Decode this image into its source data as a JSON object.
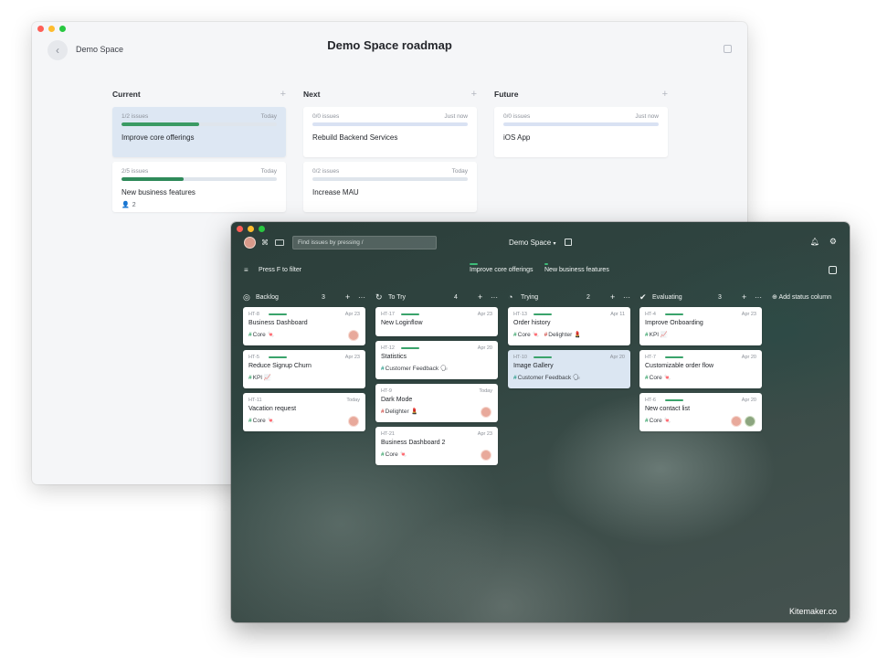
{
  "roadmap": {
    "space_name": "Demo Space",
    "title": "Demo Space roadmap",
    "columns": [
      {
        "title": "Current",
        "cards": [
          {
            "issues": "1/2 issues",
            "time": "Today",
            "progress": 0.5,
            "title": "Improve core offerings",
            "selected": true
          },
          {
            "issues": "2/5 issues",
            "time": "Today",
            "progress": 0.4,
            "title": "New business features",
            "members": "2"
          }
        ]
      },
      {
        "title": "Next",
        "cards": [
          {
            "issues": "0/0 issues",
            "time": "Just now",
            "progress": 0,
            "title": "Rebuild Backend Services"
          },
          {
            "issues": "0/2 issues",
            "time": "Today",
            "progress": 0,
            "title": "Increase MAU"
          }
        ]
      },
      {
        "title": "Future",
        "cards": [
          {
            "issues": "0/0 issues",
            "time": "Just now",
            "progress": 0,
            "title": "iOS App"
          }
        ]
      }
    ]
  },
  "board": {
    "cmd_glyph": "⌘",
    "search_placeholder": "Find issues by pressing /",
    "space_name": "Demo Space",
    "space_caret": "▾",
    "filter_text": "Press F to filter",
    "initiatives": [
      "Improve core offerings",
      "New business features"
    ],
    "add_status": "Add status column",
    "brand": "Kitemaker.co",
    "columns": [
      {
        "name": "Backlog",
        "count": "3",
        "icon": "◎",
        "cards": [
          {
            "id": "HT-8",
            "date": "Apr 23",
            "title": "Business Dashboard",
            "labels": [
              {
                "text": "Core",
                "emoji": "🍬"
              }
            ],
            "assignee": true
          },
          {
            "id": "HT-5",
            "date": "Apr 23",
            "title": "Reduce Signup Churn",
            "labels": [
              {
                "text": "KPI",
                "emoji": "📈"
              }
            ]
          },
          {
            "id": "HT-11",
            "date": "Today",
            "title": "Vacation request",
            "labels": [
              {
                "text": "Core",
                "emoji": "🍬"
              }
            ],
            "assignee": true
          }
        ]
      },
      {
        "name": "To Try",
        "count": "4",
        "icon": "↻",
        "cards": [
          {
            "id": "HT-17",
            "date": "Apr 23",
            "title": "New Loginflow",
            "labels": []
          },
          {
            "id": "HT-12",
            "date": "Apr 20",
            "title": "Statistics",
            "labels": [
              {
                "text": "Customer Feedback",
                "emoji": "🗣"
              }
            ]
          },
          {
            "id": "HT-9",
            "date": "Today",
            "title": "Dark Mode",
            "labels": [
              {
                "text": "Delighter",
                "emoji": "💄"
              }
            ],
            "assignee": true
          },
          {
            "id": "HT-21",
            "date": "Apr 23",
            "title": "Business Dashboard 2",
            "labels": [
              {
                "text": "Core",
                "emoji": "🍬"
              }
            ],
            "assignee": true
          }
        ]
      },
      {
        "name": "Trying",
        "count": "2",
        "icon": "◔",
        "cards": [
          {
            "id": "HT-13",
            "date": "Apr 11",
            "title": "Order history",
            "labels": [
              {
                "text": "Core",
                "emoji": "🍬"
              },
              {
                "text": "Delighter",
                "emoji": "💄"
              }
            ]
          },
          {
            "id": "HT-10",
            "date": "Apr 20",
            "title": "Image Gallery",
            "labels": [
              {
                "text": "Customer Feedback",
                "emoji": "🗣"
              }
            ],
            "selected": true
          }
        ]
      },
      {
        "name": "Evaluating",
        "count": "3",
        "icon": "✔",
        "cards": [
          {
            "id": "HT-4",
            "date": "Apr 23",
            "title": "Improve Onboarding",
            "labels": [
              {
                "text": "KPI",
                "emoji": "📈"
              }
            ]
          },
          {
            "id": "HT-7",
            "date": "Apr 20",
            "title": "Customizable order flow",
            "labels": [
              {
                "text": "Core",
                "emoji": "🍬"
              }
            ]
          },
          {
            "id": "HT-6",
            "date": "Apr 20",
            "title": "New contact list",
            "labels": [
              {
                "text": "Core",
                "emoji": "🍬"
              }
            ],
            "assignee": true,
            "second_assignee": true
          }
        ]
      }
    ]
  },
  "colors": {
    "progress_green": "#3a9a63",
    "label_core": "#3aa36b",
    "label_delighter": "#d1504a",
    "label_feedback": "#2b9a8a",
    "selected_card": "#dbe6f2"
  }
}
